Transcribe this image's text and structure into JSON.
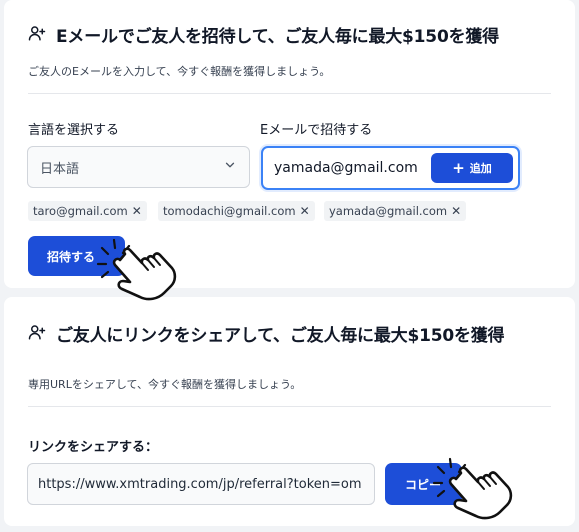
{
  "invite_card": {
    "title": "Eメールでご友人を招待して、ご友人毎に最大$150を獲得",
    "subtitle": "ご友人のEメールを入力して、今すぐ報酬を獲得しましょう。",
    "language_label": "言語を選択する",
    "language_value": "日本語",
    "email_label": "Eメールで招待する",
    "email_value": "yamada@gmail.com",
    "add_button": "追加",
    "chips": [
      "taro@gmail.com",
      "tomodachi@gmail.com",
      "yamada@gmail.com"
    ],
    "remove_glyph": "✕",
    "invite_button": "招待する"
  },
  "link_card": {
    "title": "ご友人にリンクをシェアして、ご友人毎に最大$150を獲得",
    "subtitle": "専用URLをシェアして、今すぐ報酬を獲得しましょう。",
    "link_label": "リンクをシェアする：",
    "url_value": "https://www.xmtrading.com/jp/referral?token=om",
    "copy_button": "コピー"
  },
  "icons": {
    "title_icon": "user-plus-icon",
    "select_icon": "chevron-down-icon",
    "cursor_icon": "hand-pointer-click-icon"
  },
  "colors": {
    "primary": "#1d4ed8",
    "focus_border": "#3b82f6",
    "background": "#f1f3f6"
  }
}
